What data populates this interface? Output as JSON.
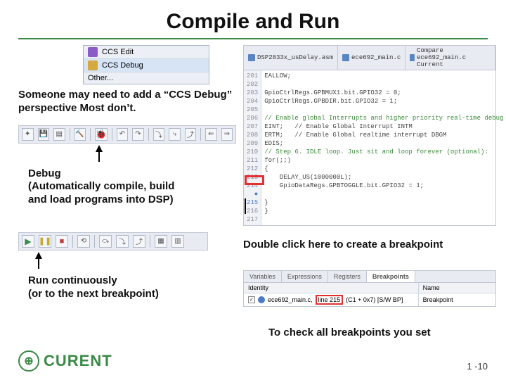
{
  "title": "Compile and Run",
  "perspective": {
    "items": [
      {
        "label": "CCS Edit"
      },
      {
        "label": "CCS Debug"
      },
      {
        "label": "Other..."
      }
    ]
  },
  "note_add_perspective": "Someone may need to add a “CCS Debug” perspective Most don’t.",
  "toolbar1_icons": [
    "new",
    "save",
    "save-all",
    "sep",
    "build",
    "sep",
    "bug",
    "sep",
    "undo",
    "redo",
    "sep",
    "step",
    "step-into",
    "step-out",
    "sep",
    "fwd",
    "back"
  ],
  "caption_debug": "Debug\n(Automatically compile, build\n and load programs into DSP)",
  "toolbar2_icons": [
    "play",
    "pause",
    "stop",
    "sep",
    "restart",
    "sep",
    "step",
    "step-over",
    "step-return",
    "sep",
    "cfg",
    "cfg2"
  ],
  "caption_run": "Run continuously\n(or to the next breakpoint)",
  "editor": {
    "tabs": [
      "DSP2833x_usDelay.asm",
      "ece692_main.c",
      "Compare ece692_main.c Current"
    ],
    "gutter_start": 201,
    "lines": [
      "EALLOW;",
      "",
      "GpioCtrlRegs.GPBMUX1.bit.GPIO32 = 0;",
      "GpioCtrlRegs.GPBDIR.bit.GPIO32 = 1;",
      "",
      "// Enable global Interrupts and higher priority real-time debug ev",
      "EINT;   // Enable Global Interrupt INTM",
      "ERTM;   // Enable Global realtime interrupt DBGM",
      "EDIS;",
      "// Step 6. IDLE loop. Just sit and loop forever (optional):",
      "for(;;)",
      "{",
      "    DELAY_US(1000000L);",
      "    GpioDataRegs.GPBTOGGLE.bit.GPIO32 = 1;",
      "",
      "}",
      "}"
    ],
    "breakpoint_line": 215
  },
  "caption_breakpoint": "Double click here to create a breakpoint",
  "bp_panel": {
    "tabs": [
      "Variables",
      "Expressions",
      "Registers",
      "Breakpoints"
    ],
    "active_tab": 3,
    "columns": [
      "Identity",
      "Name"
    ],
    "row": {
      "file": "ece692_main.c,",
      "line_text": "line 215",
      "cond": "(C1 + 0x7) [S/W BP]",
      "name": "Breakpoint"
    }
  },
  "caption_check_bp": "To check all breakpoints you set",
  "logo_text": "CURENT",
  "page_number": "1 -10"
}
